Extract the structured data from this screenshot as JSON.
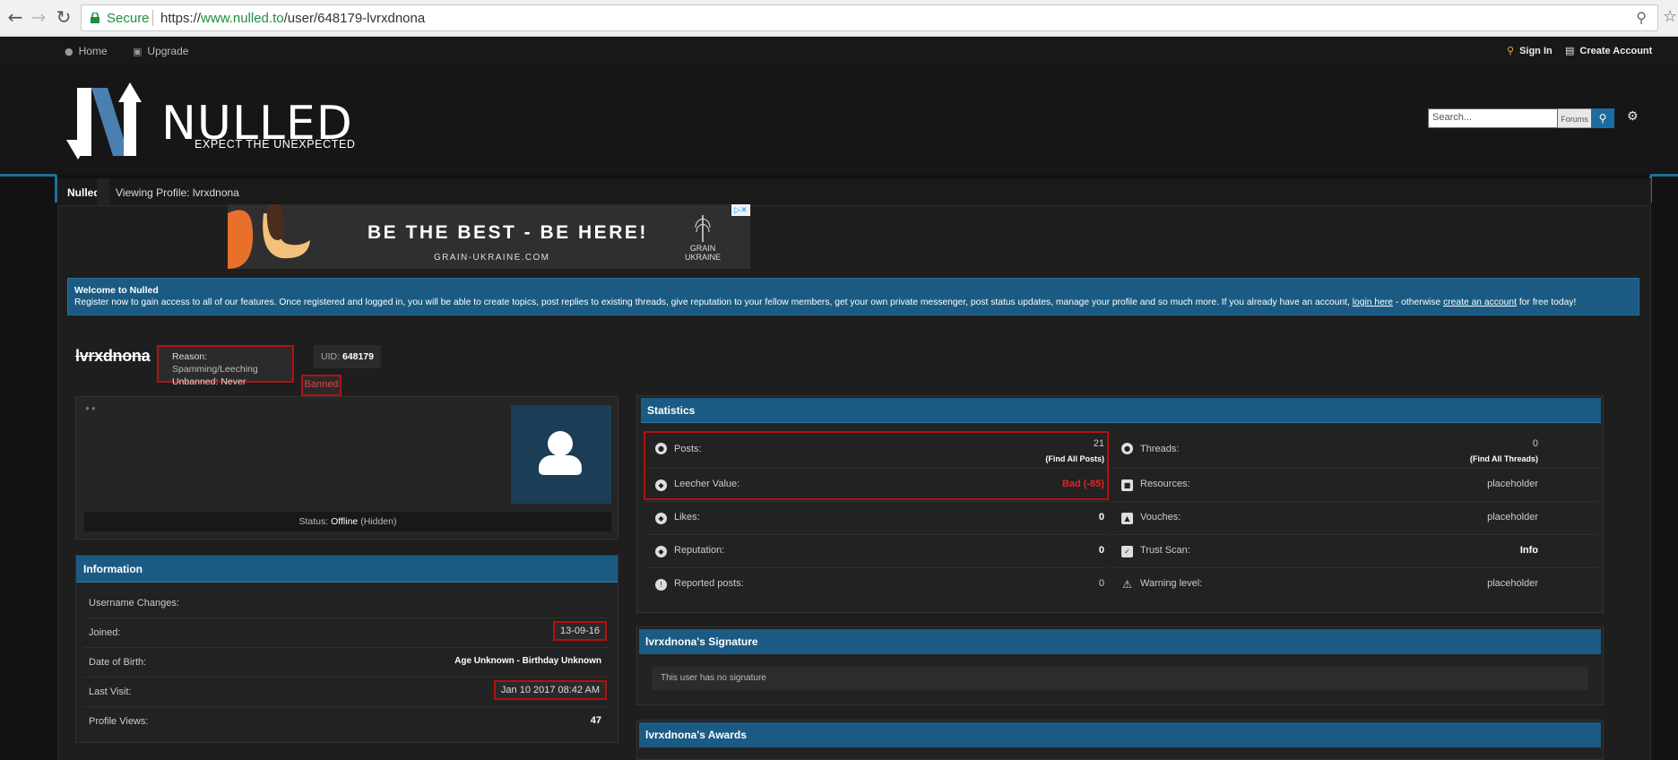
{
  "browser": {
    "secure_label": "Secure",
    "url_scheme": "https://",
    "url_host": "www.nulled.to",
    "url_path": "/user/648179-lvrxdnona"
  },
  "topbar": {
    "home": "Home",
    "upgrade": "Upgrade",
    "sign_in": "Sign In",
    "create_account": "Create Account"
  },
  "header": {
    "logo_text": "NULLED",
    "tagline": "EXPECT THE UNEXPECTED",
    "search_placeholder": "Search...",
    "search_scope": "Forums"
  },
  "breadcrumb": {
    "home": "Nulled",
    "current": "Viewing Profile: lvrxdnona"
  },
  "ad": {
    "headline": "BE THE BEST - BE HERE!",
    "url": "GRAIN-UKRAINE.COM",
    "brand": "GRAIN UKRAINE"
  },
  "welcome": {
    "title": "Welcome to Nulled",
    "body": "Register now to gain access to all of our features. Once registered and logged in, you will be able to create topics, post replies to existing threads, give reputation to your fellow members, get your own private messenger, post status updates, manage your profile and so much more. If you already have an account, ",
    "login_link": "login here",
    "middle": " - otherwise ",
    "create_link": "create an account",
    "tail": " for free today!"
  },
  "profile": {
    "username": "lvrxdnona",
    "ban_reason_label": "Reason:",
    "ban_reason": "Spamming/Leeching",
    "unbanned_label": "Unbanned:",
    "unbanned": "Never",
    "uid_label": "UID:",
    "uid": "648179",
    "banned_tag": "Banned",
    "status_label": "Status:",
    "status_value": "Offline",
    "status_extra": "(Hidden)"
  },
  "information": {
    "title": "Information",
    "rows": [
      {
        "label": "Username Changes:",
        "value": ""
      },
      {
        "label": "Joined:",
        "value": "13-09-16"
      },
      {
        "label": "Date of Birth:",
        "value": "Age Unknown - Birthday Unknown"
      },
      {
        "label": "Last Visit:",
        "value": "Jan 10 2017 08:42 AM"
      },
      {
        "label": "Profile Views:",
        "value": "47"
      }
    ]
  },
  "statistics": {
    "title": "Statistics",
    "posts_label": "Posts:",
    "posts_value": "21",
    "posts_link": "(Find All Posts)",
    "threads_label": "Threads:",
    "threads_value": "0",
    "threads_link": "(Find All Threads)",
    "leecher_label": "Leecher Value:",
    "leecher_value": "Bad (-85)",
    "resources_label": "Resources:",
    "resources_value": "placeholder",
    "likes_label": "Likes:",
    "likes_value": "0",
    "vouches_label": "Vouches:",
    "vouches_value": "placeholder",
    "reputation_label": "Reputation:",
    "reputation_value": "0",
    "trust_label": "Trust Scan:",
    "trust_value": "Info",
    "reported_label": "Reported posts:",
    "reported_value": "0",
    "warning_label": "Warning level:",
    "warning_value": "placeholder"
  },
  "signature": {
    "title": "lvrxdnona's Signature",
    "body": "This user has no signature"
  },
  "awards": {
    "title": "lvrxdnona's Awards"
  },
  "colors": {
    "accent_blue": "#1b5b83",
    "highlight_red": "#b31111",
    "leecher_red": "#e02424"
  }
}
